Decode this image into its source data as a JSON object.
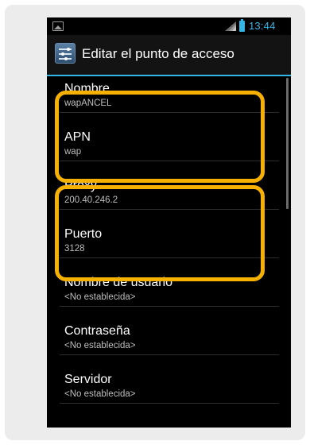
{
  "statusbar": {
    "time": "13:44",
    "icons": [
      "image-notification-icon",
      "signal-icon",
      "battery-icon"
    ]
  },
  "actionbar": {
    "title": "Editar el punto de acceso",
    "icon": "apn-settings-icon"
  },
  "fields": [
    {
      "label": "Nombre",
      "value": "wapANCEL"
    },
    {
      "label": "APN",
      "value": "wap"
    },
    {
      "label": "Proxy",
      "value": "200.40.246.2"
    },
    {
      "label": "Puerto",
      "value": "3128"
    },
    {
      "label": "Nombre de usuario",
      "value": "<No establecida>"
    },
    {
      "label": "Contraseña",
      "value": "<No establecida>"
    },
    {
      "label": "Servidor",
      "value": "<No establecida>"
    }
  ],
  "colors": {
    "accent": "#33b5e5",
    "highlight": "#f6b000",
    "background": "#000000",
    "frame": "#ececec"
  }
}
